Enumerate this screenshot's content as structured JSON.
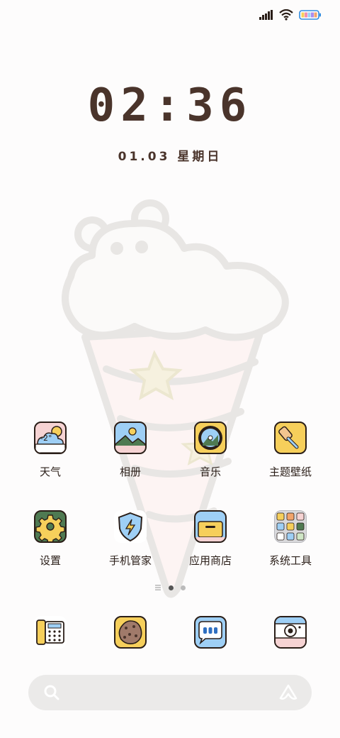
{
  "status_bar": {
    "signal_icon": "signal-icon",
    "wifi_icon": "wifi-icon",
    "battery_icon": "battery-icon"
  },
  "clock": {
    "time": "02:36",
    "date": "01.03 星期日"
  },
  "apps": [
    {
      "label": "天气",
      "icon": "weather-icon",
      "badge": "-2°"
    },
    {
      "label": "相册",
      "icon": "gallery-icon"
    },
    {
      "label": "音乐",
      "icon": "music-icon"
    },
    {
      "label": "主题壁纸",
      "icon": "theme-wallpaper-icon"
    },
    {
      "label": "设置",
      "icon": "settings-gear-icon"
    },
    {
      "label": "手机管家",
      "icon": "security-shield-icon"
    },
    {
      "label": "应用商店",
      "icon": "app-store-icon"
    },
    {
      "label": "系统工具",
      "icon": "system-tools-folder-icon"
    }
  ],
  "dock": [
    {
      "icon": "phone-icon"
    },
    {
      "icon": "browser-cookie-icon"
    },
    {
      "icon": "messages-icon"
    },
    {
      "icon": "camera-icon"
    }
  ],
  "colors": {
    "accent_brown": "#4a342b",
    "yellow": "#f6cf5b",
    "blue": "#9ecff5",
    "pink": "#f6d3d3",
    "green": "#4f7a52"
  }
}
